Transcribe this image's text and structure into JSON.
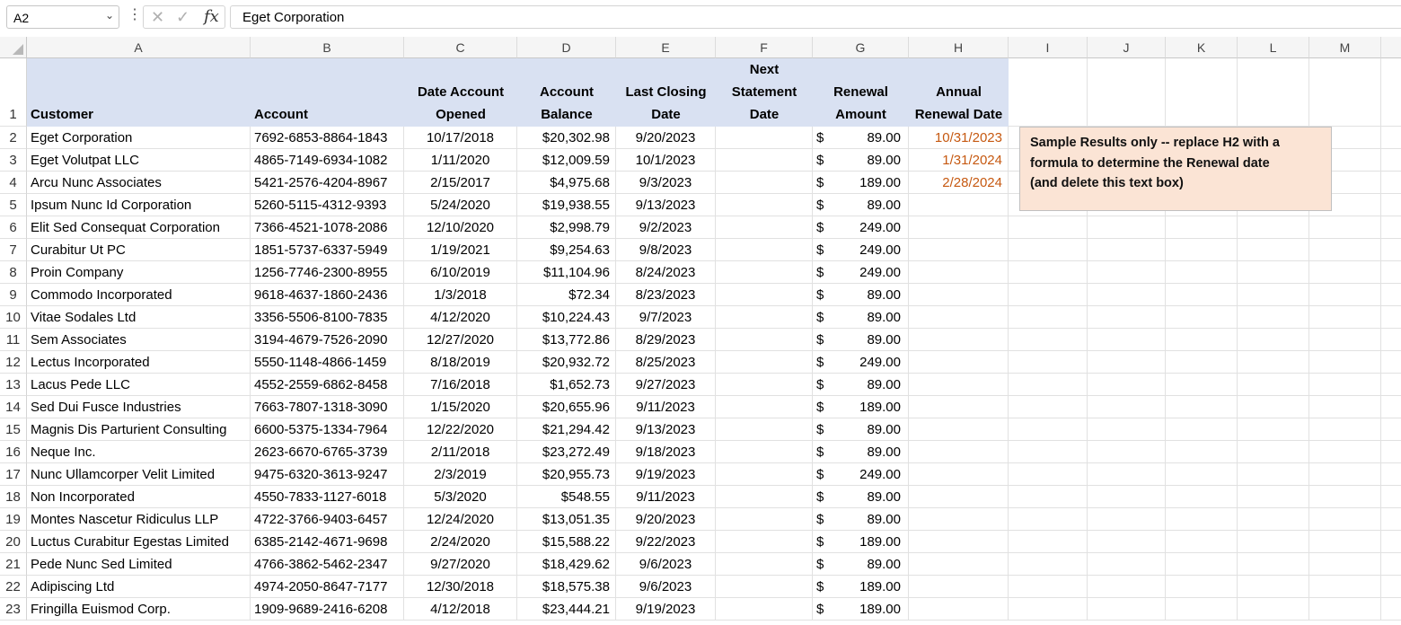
{
  "formula_bar": {
    "name_box": "A2",
    "formula": "Eget Corporation"
  },
  "columns": [
    "A",
    "B",
    "C",
    "D",
    "E",
    "F",
    "G",
    "H",
    "I",
    "J",
    "K",
    "L",
    "M"
  ],
  "headers": {
    "customer": "Customer",
    "account": "Account",
    "date_opened_1": "Date Account",
    "date_opened_2": "Opened",
    "balance_1": "Account",
    "balance_2": "Balance",
    "last_closing_1": "Last Closing",
    "last_closing_2": "Date",
    "next_stmt_1": "Next",
    "next_stmt_2": "Statement",
    "next_stmt_3": "Date",
    "renewal_amt_1": "Renewal",
    "renewal_amt_2": "Amount",
    "annual_1": "Annual",
    "annual_2": "Renewal Date"
  },
  "rows": [
    {
      "n": "2",
      "customer": "Eget Corporation",
      "account": "7692-6853-8864-1843",
      "opened": "10/17/2018",
      "balance": "$20,302.98",
      "closing": "9/20/2023",
      "cur": "$",
      "amount": "89.00",
      "annual": "10/31/2023"
    },
    {
      "n": "3",
      "customer": "Eget Volutpat LLC",
      "account": "4865-7149-6934-1082",
      "opened": "1/11/2020",
      "balance": "$12,009.59",
      "closing": "10/1/2023",
      "cur": "$",
      "amount": "89.00",
      "annual": "1/31/2024"
    },
    {
      "n": "4",
      "customer": "Arcu Nunc Associates",
      "account": "5421-2576-4204-8967",
      "opened": "2/15/2017",
      "balance": "$4,975.68",
      "closing": "9/3/2023",
      "cur": "$",
      "amount": "189.00",
      "annual": "2/28/2024"
    },
    {
      "n": "5",
      "customer": "Ipsum Nunc Id Corporation",
      "account": "5260-5115-4312-9393",
      "opened": "5/24/2020",
      "balance": "$19,938.55",
      "closing": "9/13/2023",
      "cur": "$",
      "amount": "89.00",
      "annual": ""
    },
    {
      "n": "6",
      "customer": "Elit Sed Consequat Corporation",
      "account": "7366-4521-1078-2086",
      "opened": "12/10/2020",
      "balance": "$2,998.79",
      "closing": "9/2/2023",
      "cur": "$",
      "amount": "249.00",
      "annual": ""
    },
    {
      "n": "7",
      "customer": "Curabitur Ut PC",
      "account": "1851-5737-6337-5949",
      "opened": "1/19/2021",
      "balance": "$9,254.63",
      "closing": "9/8/2023",
      "cur": "$",
      "amount": "249.00",
      "annual": ""
    },
    {
      "n": "8",
      "customer": "Proin Company",
      "account": "1256-7746-2300-8955",
      "opened": "6/10/2019",
      "balance": "$11,104.96",
      "closing": "8/24/2023",
      "cur": "$",
      "amount": "249.00",
      "annual": ""
    },
    {
      "n": "9",
      "customer": "Commodo Incorporated",
      "account": "9618-4637-1860-2436",
      "opened": "1/3/2018",
      "balance": "$72.34",
      "closing": "8/23/2023",
      "cur": "$",
      "amount": "89.00",
      "annual": ""
    },
    {
      "n": "10",
      "customer": "Vitae Sodales Ltd",
      "account": "3356-5506-8100-7835",
      "opened": "4/12/2020",
      "balance": "$10,224.43",
      "closing": "9/7/2023",
      "cur": "$",
      "amount": "89.00",
      "annual": ""
    },
    {
      "n": "11",
      "customer": "Sem Associates",
      "account": "3194-4679-7526-2090",
      "opened": "12/27/2020",
      "balance": "$13,772.86",
      "closing": "8/29/2023",
      "cur": "$",
      "amount": "89.00",
      "annual": ""
    },
    {
      "n": "12",
      "customer": "Lectus Incorporated",
      "account": "5550-1148-4866-1459",
      "opened": "8/18/2019",
      "balance": "$20,932.72",
      "closing": "8/25/2023",
      "cur": "$",
      "amount": "249.00",
      "annual": ""
    },
    {
      "n": "13",
      "customer": "Lacus Pede LLC",
      "account": "4552-2559-6862-8458",
      "opened": "7/16/2018",
      "balance": "$1,652.73",
      "closing": "9/27/2023",
      "cur": "$",
      "amount": "89.00",
      "annual": ""
    },
    {
      "n": "14",
      "customer": "Sed Dui Fusce Industries",
      "account": "7663-7807-1318-3090",
      "opened": "1/15/2020",
      "balance": "$20,655.96",
      "closing": "9/11/2023",
      "cur": "$",
      "amount": "189.00",
      "annual": ""
    },
    {
      "n": "15",
      "customer": "Magnis Dis Parturient Consulting",
      "account": "6600-5375-1334-7964",
      "opened": "12/22/2020",
      "balance": "$21,294.42",
      "closing": "9/13/2023",
      "cur": "$",
      "amount": "89.00",
      "annual": ""
    },
    {
      "n": "16",
      "customer": "Neque Inc.",
      "account": "2623-6670-6765-3739",
      "opened": "2/11/2018",
      "balance": "$23,272.49",
      "closing": "9/18/2023",
      "cur": "$",
      "amount": "89.00",
      "annual": ""
    },
    {
      "n": "17",
      "customer": "Nunc Ullamcorper Velit Limited",
      "account": "9475-6320-3613-9247",
      "opened": "2/3/2019",
      "balance": "$20,955.73",
      "closing": "9/19/2023",
      "cur": "$",
      "amount": "249.00",
      "annual": ""
    },
    {
      "n": "18",
      "customer": "Non Incorporated",
      "account": "4550-7833-1127-6018",
      "opened": "5/3/2020",
      "balance": "$548.55",
      "closing": "9/11/2023",
      "cur": "$",
      "amount": "89.00",
      "annual": ""
    },
    {
      "n": "19",
      "customer": "Montes Nascetur Ridiculus LLP",
      "account": "4722-3766-9403-6457",
      "opened": "12/24/2020",
      "balance": "$13,051.35",
      "closing": "9/20/2023",
      "cur": "$",
      "amount": "89.00",
      "annual": ""
    },
    {
      "n": "20",
      "customer": "Luctus Curabitur Egestas Limited",
      "account": "6385-2142-4671-9698",
      "opened": "2/24/2020",
      "balance": "$15,588.22",
      "closing": "9/22/2023",
      "cur": "$",
      "amount": "189.00",
      "annual": ""
    },
    {
      "n": "21",
      "customer": "Pede Nunc Sed Limited",
      "account": "4766-3862-5462-2347",
      "opened": "9/27/2020",
      "balance": "$18,429.62",
      "closing": "9/6/2023",
      "cur": "$",
      "amount": "89.00",
      "annual": ""
    },
    {
      "n": "22",
      "customer": "Adipiscing Ltd",
      "account": "4974-2050-8647-7177",
      "opened": "12/30/2018",
      "balance": "$18,575.38",
      "closing": "9/6/2023",
      "cur": "$",
      "amount": "189.00",
      "annual": ""
    },
    {
      "n": "23",
      "customer": "Fringilla Euismod Corp.",
      "account": "1909-9689-2416-6208",
      "opened": "4/12/2018",
      "balance": "$23,444.21",
      "closing": "9/19/2023",
      "cur": "$",
      "amount": "189.00",
      "annual": ""
    }
  ],
  "note": {
    "line1": "Sample Results only -- replace H2 with a",
    "line2": "formula to determine the Renewal date",
    "line3": "(and delete this text box)"
  },
  "colors": {
    "header_fill": "#d9e1f2",
    "note_fill": "#fbe4d5",
    "annual_text": "#c65911"
  }
}
